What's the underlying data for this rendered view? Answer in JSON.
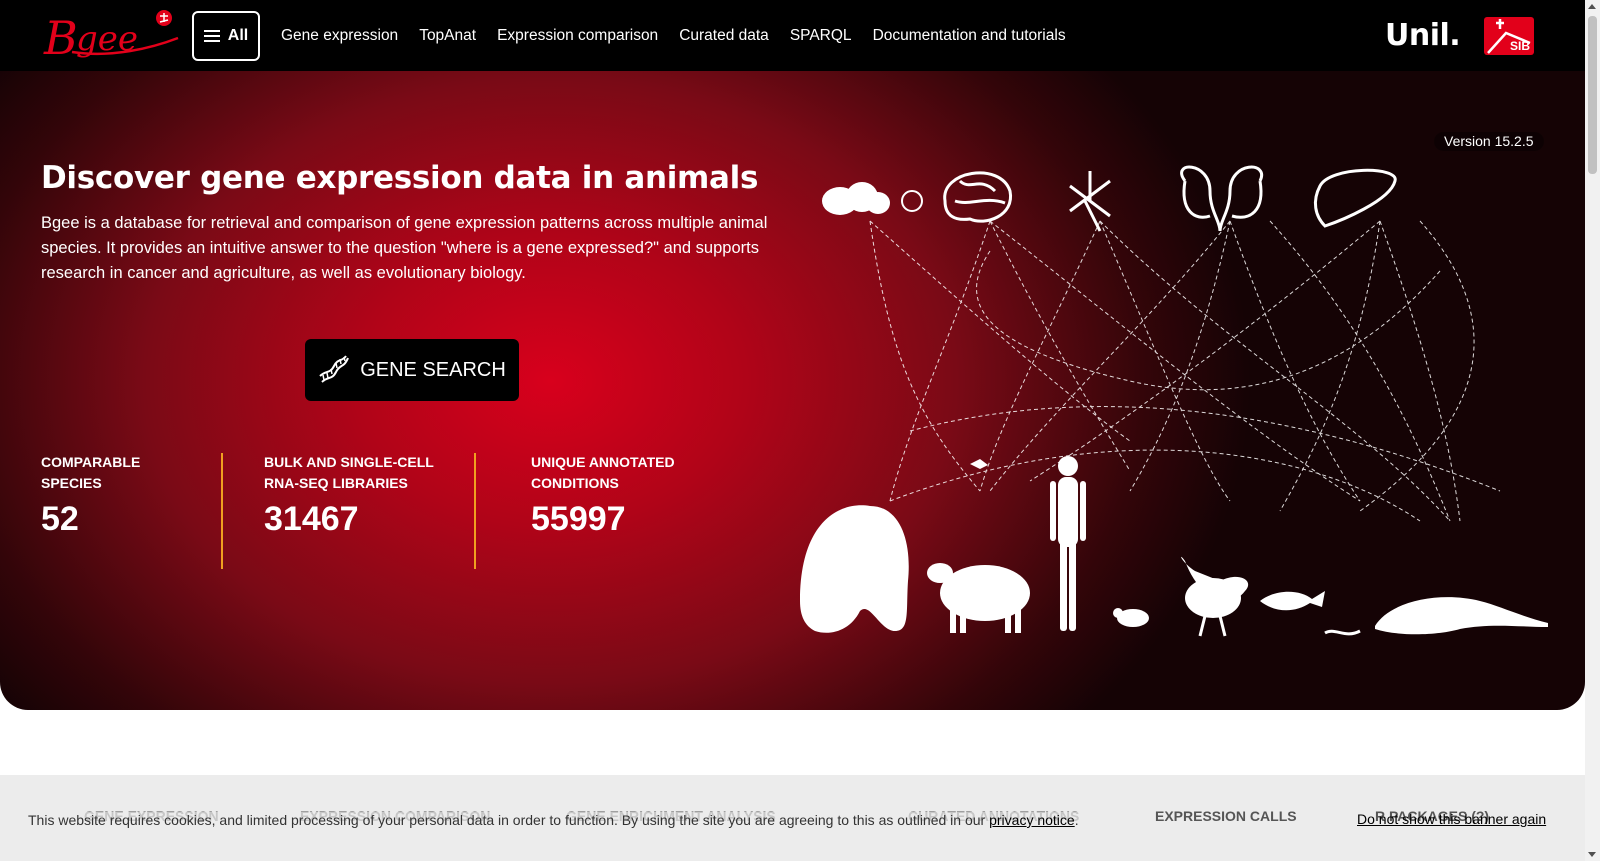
{
  "nav": {
    "all_label": "All",
    "links": [
      "Gene expression",
      "TopAnat",
      "Expression comparison",
      "Curated data",
      "SPARQL",
      "Documentation and tutorials"
    ],
    "unil_label": "Unil.",
    "sib_label": "SIB"
  },
  "hero": {
    "version": "Version 15.2.5",
    "title": "Discover gene expression data in animals",
    "description": "Bgee is a database for retrieval and comparison of gene expression patterns across multiple animal species. It provides an intuitive answer to the question \"where is a gene expressed?\" and supports research in cancer and agriculture, as well as evolutionary biology.",
    "search_label": "GENE SEARCH",
    "stats": [
      {
        "label": "COMPARABLE SPECIES",
        "value": "52"
      },
      {
        "label": "BULK AND SINGLE-CELL RNA-SEQ LIBRARIES",
        "value": "31467"
      },
      {
        "label": "UNIQUE ANNOTATED CONDITIONS",
        "value": "55997"
      }
    ]
  },
  "cookie": {
    "tabs": [
      "GENE EXPRESSION",
      "EXPRESSION COMPARISON",
      "GENE ENRICHMENT ANALYSIS",
      "CURATED ANNOTATIONS",
      "EXPRESSION CALLS",
      "R PACKAGES (?)"
    ],
    "message": "This website requires cookies, and limited processing of your personal data in order to function. By using the site you are agreeing to this as outlined in our",
    "privacy_link": "privacy notice",
    "period": ".",
    "dismiss": "Do not show this banner again"
  },
  "colors": {
    "hero_red": "#d8001c",
    "divider_orange": "#f0a020",
    "sib_red": "#e2001a"
  }
}
